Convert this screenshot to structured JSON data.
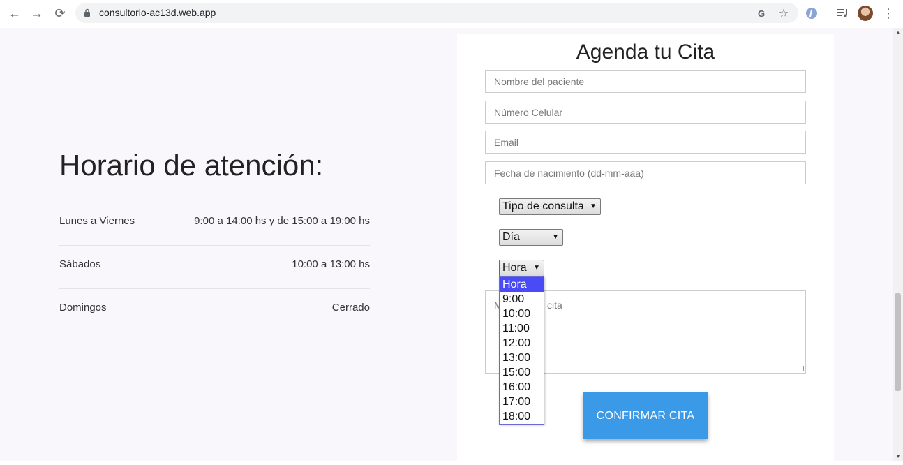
{
  "browser": {
    "back_icon": "←",
    "forward_icon": "→",
    "reload_icon": "⟳",
    "url": "consultorio-ac13d.web.app",
    "translate_icon": "G",
    "star_icon": "☆",
    "menu_icon": "⋮"
  },
  "schedule": {
    "title": "Horario de atención:",
    "rows": [
      {
        "day": "Lunes a Viernes",
        "time": "9:00 a 14:00 hs y de 15:00 a 19:00 hs"
      },
      {
        "day": "Sábados",
        "time": "10:00 a 13:00 hs"
      },
      {
        "day": "Domingos",
        "time": "Cerrado"
      }
    ]
  },
  "form": {
    "title": "Agenda tu Cita",
    "name_placeholder": "Nombre del paciente",
    "phone_placeholder": "Número Celular",
    "email_placeholder": "Email",
    "birth_placeholder": "Fecha de nacimiento (dd-mm-aaa)",
    "consult_type": "Tipo de consulta",
    "day": "Día",
    "hour": "Hora",
    "message_visible_start": "M",
    "message_visible_end": "cita",
    "confirm_label": "CONFIRMAR CITA"
  },
  "hour_options": [
    "Hora",
    "9:00",
    "10:00",
    "11:00",
    "12:00",
    "13:00",
    "15:00",
    "16:00",
    "17:00",
    "18:00"
  ],
  "colors": {
    "accent": "#3a9ae8",
    "selected_option": "#4a4af7",
    "page_bg": "#f9f7fc"
  }
}
